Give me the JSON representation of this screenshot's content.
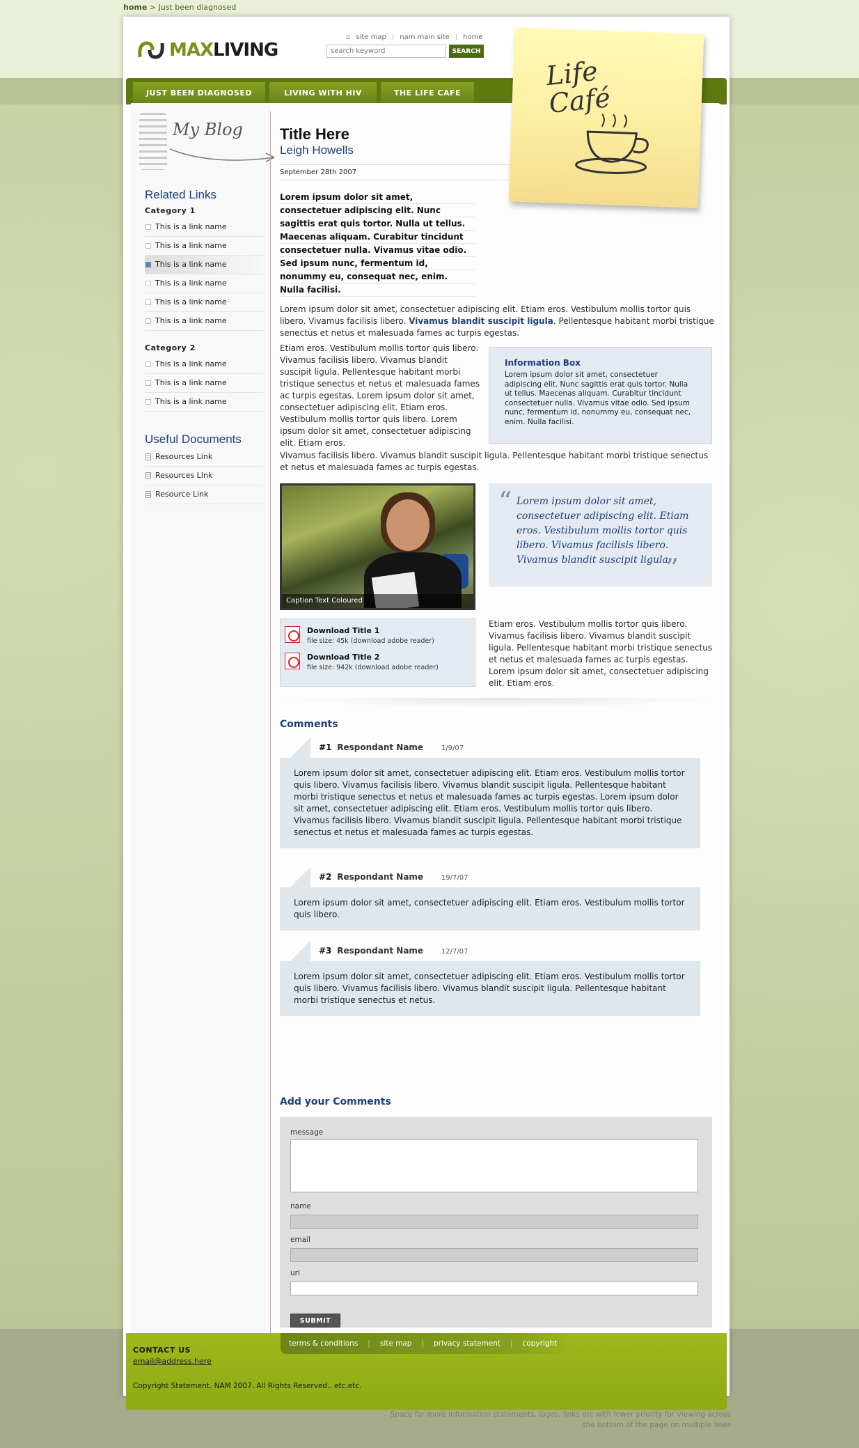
{
  "breadcrumb": {
    "home": "home",
    "sep": " > ",
    "current": "Just been diagnosed"
  },
  "brand": {
    "max": "MAX",
    "living": "LIVING",
    "accent": "#78921b"
  },
  "header": {
    "toplinks": [
      "site map",
      "nam main site",
      "home"
    ],
    "search_placeholder": "search keyword",
    "search_button": "SEARCH"
  },
  "nav": [
    "JUST BEEN DIAGNOSED",
    "LIVING WITH HIV",
    "THE LIFE CAFE"
  ],
  "sticky_note": {
    "line1": "Life",
    "line2": "Café"
  },
  "sidebar": {
    "blog_label": "My Blog",
    "related_title": "Related Links",
    "cat1": "Category 1",
    "cat1_links": [
      "This is a link name",
      "This is a link name",
      "This is a link name",
      "This is a link name",
      "This is a link name",
      "This is a link name"
    ],
    "cat2": "Category 2",
    "cat2_links": [
      "This is a link name",
      "This is a link name",
      "This is a link name"
    ],
    "docs_title": "Useful Documents",
    "docs": [
      "Resources Link",
      "Resources LInk",
      "Resource Link"
    ]
  },
  "article": {
    "title": "Title Here",
    "author": "Leigh Howells",
    "date": "September 28th 2007",
    "lead": "Lorem ipsum dolor sit amet, consectetuer adipiscing elit. Nunc sagittis erat quis tortor. Nulla ut tellus. Maecenas aliquam. Curabitur tincidunt consectetuer nulla. Vivamus vitae odio. Sed ipsum nunc, fer­mentum id, nonummy eu, consequat nec, enim. Nulla facilisi.",
    "p1_a": "Lorem ipsum dolor sit amet, consectetuer adipiscing elit. Etiam eros. Vestibulum mollis tortor quis libero. Vivamus facilisis libero. ",
    "p1_link": "Vivamus blandit suscipit ligula",
    "p1_b": ". Pellentesque habitant morbi tris­tique senectus et netus et malesuada fames ac turpis egestas.",
    "p2": "Etiam eros. Vestibulum mollis tortor quis libero. Vivamus facilisis libero. Vivamus blan­dit suscipit ligula. Pellentesque habitant morbi tristique senectus et netus et male­suada fames ac turpis egestas. Lorem ipsum dolor sit amet, consectetuer adipiscing elit. Etiam eros. Vestibulum mollis tortor quis libero.  Lorem ipsum dolor sit amet, consect­etuer adipiscing elit. Etiam eros.",
    "info_title": "Information Box",
    "info_text": "Lorem ipsum dolor sit amet, consectetuer adipiscing elit. Nunc sagittis erat quis tortor. Nulla ut tellus. Maecenas aliquam. Curabitur tincidunt consectetuer nulla. Vivamus vitae odio. Sed ipsum nunc, fermentum id, nonummy eu, consequat nec, enim. Nulla facilisi.",
    "p3": "Vivamus facilisis libero. Vivamus blandit suscipit ligula. Pellentesque habitant morbi tristique senec­tus et netus et malesuada fames ac turpis egestas.",
    "photo_caption": "Caption Text Coloured",
    "quote": "Lorem ipsum dolor sit amet, consectetuer adipiscing elit. Etiam eros. Vestibulum mollis tortor quis libero. Vivamus facilisis libero. Vivamus blandit suscipit ligula.",
    "downloads": [
      {
        "title": "Download Title 1",
        "meta": "file size: 45k (download adobe reader)"
      },
      {
        "title": "Download Title 2",
        "meta": "file size: 942k (download adobe reader)"
      }
    ],
    "p4": "Etiam eros. Vestibulum mollis tortor quis libero. Vivamus facilisis libero. Vivamus blandit suscipit ligula. Pellentesque habitant morbi tristique senectus et netus et malesuada fames ac turpis egestas. Lorem ipsum dolor sit amet, consect­etuer adipiscing elit. Etiam eros."
  },
  "comments": {
    "heading": "Comments",
    "items": [
      {
        "num": "#1",
        "name": "Respondant Name",
        "date": "1/9/07",
        "text": "Lorem ipsum dolor sit amet, consectetuer adipiscing elit. Etiam eros. Vestibulum mollis tortor quis libero. Vivamus facilisis libero. Vivamus blandit suscipit ligula. Pellentesque habitant morbi tristique senectus et netus et malesuada fames ac turpis egestas. Lorem ipsum dolor sit amet, consectetuer adipiscing elit. Etiam eros. Vestibulum mollis tortor quis libero. Vivamus facilisis libero. Vivamus blandit suscipit ligula. Pellentesque habitant morbi tristique senectus et netus et malesuada fames ac turpis egestas."
      },
      {
        "num": "#2",
        "name": "Respondant Name",
        "date": "19/7/07",
        "text": "Lorem ipsum dolor sit amet, consectetuer adipiscing elit. Etiam eros. Vestibulum mollis tortor quis libero."
      },
      {
        "num": "#3",
        "name": "Respondant Name",
        "date": "12/7/07",
        "text": "Lorem ipsum dolor sit amet, consectetuer adipiscing elit. Etiam eros. Vestibulum mollis tortor quis libero. Vivamus facilisis libero. Vivamus blandit suscipit ligula. Pellentesque habitant morbi tristique senectus et netus."
      }
    ]
  },
  "form": {
    "heading": "Add your Comments",
    "message_label": "message",
    "name_label": "name",
    "email_label": "email",
    "url_label": "url",
    "submit": "SUBMIT"
  },
  "footer": {
    "links": [
      "terms & conditions",
      "site map",
      "privacy statement",
      "copyright"
    ],
    "contact": "CONTACT US",
    "email": "email@address.here",
    "copyright": "Copyright Statement.  NAM 2007.  All Rights Reserved.. etc.etc.",
    "extra": "Space for more information statements, logos, links etc with lower priority for viewing across the bottom of the page on multiple lines"
  }
}
